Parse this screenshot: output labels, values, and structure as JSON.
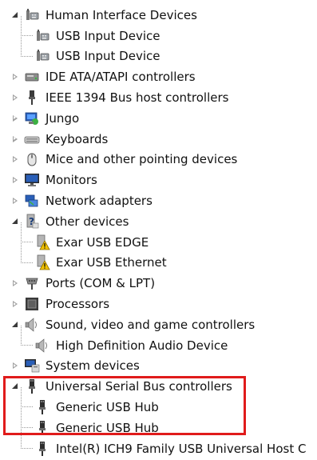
{
  "tree": {
    "items": [
      {
        "label": "Human Interface Devices",
        "level": 0,
        "state": "expanded",
        "icon": "hid-icon"
      },
      {
        "label": "USB Input Device",
        "level": 1,
        "icon": "hid-icon"
      },
      {
        "label": "USB Input Device",
        "level": 1,
        "icon": "hid-icon"
      },
      {
        "label": "IDE ATA/ATAPI controllers",
        "level": 0,
        "state": "collapsed",
        "icon": "ide-controller-icon"
      },
      {
        "label": "IEEE 1394 Bus host controllers",
        "level": 0,
        "state": "collapsed",
        "icon": "ieee1394-icon"
      },
      {
        "label": "Jungo",
        "level": 0,
        "state": "collapsed",
        "icon": "jungo-icon"
      },
      {
        "label": "Keyboards",
        "level": 0,
        "state": "collapsed",
        "icon": "keyboard-icon"
      },
      {
        "label": "Mice and other pointing devices",
        "level": 0,
        "state": "collapsed",
        "icon": "mouse-icon"
      },
      {
        "label": "Monitors",
        "level": 0,
        "state": "collapsed",
        "icon": "monitor-icon"
      },
      {
        "label": "Network adapters",
        "level": 0,
        "state": "collapsed",
        "icon": "network-adapter-icon"
      },
      {
        "label": "Other devices",
        "level": 0,
        "state": "expanded",
        "icon": "unknown-device-icon"
      },
      {
        "label": "Exar USB EDGE",
        "level": 1,
        "icon": "unknown-device-warning-icon"
      },
      {
        "label": "Exar USB Ethernet",
        "level": 1,
        "icon": "unknown-device-warning-icon"
      },
      {
        "label": "Ports (COM & LPT)",
        "level": 0,
        "state": "collapsed",
        "icon": "port-icon"
      },
      {
        "label": "Processors",
        "level": 0,
        "state": "collapsed",
        "icon": "processor-icon"
      },
      {
        "label": "Sound, video and game controllers",
        "level": 0,
        "state": "expanded",
        "icon": "speaker-icon"
      },
      {
        "label": "High Definition Audio Device",
        "level": 1,
        "icon": "speaker-icon"
      },
      {
        "label": "System devices",
        "level": 0,
        "state": "collapsed",
        "icon": "system-device-icon"
      },
      {
        "label": "Universal Serial Bus controllers",
        "level": 0,
        "state": "expanded",
        "icon": "usb-plug-icon"
      },
      {
        "label": "Generic USB Hub",
        "level": 1,
        "icon": "usb-plug-icon"
      },
      {
        "label": "Generic USB Hub",
        "level": 1,
        "icon": "usb-plug-icon"
      },
      {
        "label": "Intel(R) ICH9 Family USB Universal Host C",
        "level": 1,
        "icon": "usb-plug-icon"
      }
    ]
  },
  "colors": {
    "highlight": "#e01b1b",
    "warning": "#f2c200",
    "monitor_blue": "#2a5fb8"
  }
}
